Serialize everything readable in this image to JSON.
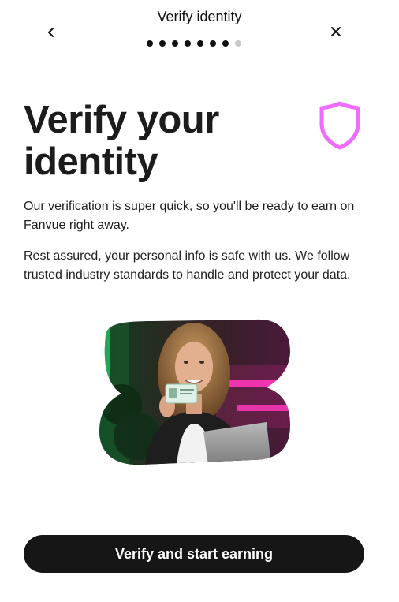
{
  "header": {
    "title": "Verify identity",
    "steps_total": 8,
    "steps_current": 7
  },
  "main": {
    "headline": "Verify your identity",
    "paragraph_1": "Our verification is super quick, so you'll be ready to earn on Fanvue right away.",
    "paragraph_2": "Rest assured, your personal info is safe with us. We follow trusted industry standards to handle and protect your data."
  },
  "cta": {
    "label": "Verify and start earning"
  },
  "icons": {
    "back": "chevron-left-icon",
    "close": "close-icon",
    "shield": "shield-icon"
  },
  "colors": {
    "accent_pink": "#f06bff",
    "button_bg": "#161616",
    "dot_active": "#111111",
    "dot_inactive": "#c8c8c8"
  }
}
